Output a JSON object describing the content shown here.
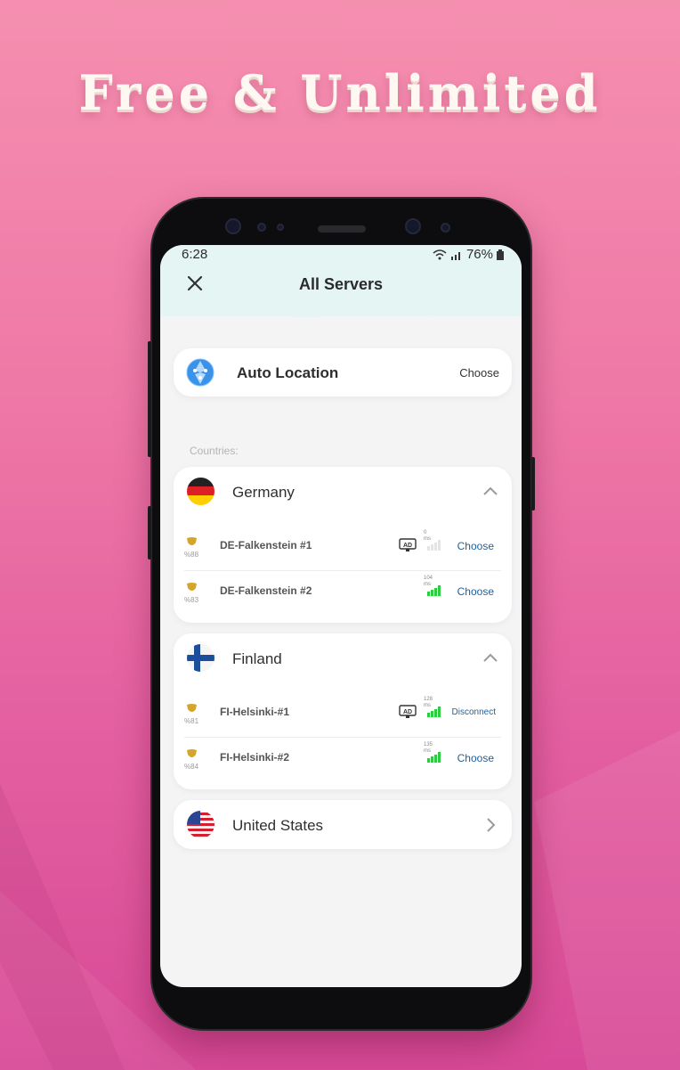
{
  "headline": "Free & Unlimited",
  "status_bar": {
    "time": "6:28",
    "battery": "76%"
  },
  "header": {
    "title": "All Servers"
  },
  "auto_location": {
    "label": "Auto Location",
    "action": "Choose"
  },
  "countries_label": "Countries:",
  "countries": [
    {
      "name": "Germany",
      "expanded": true,
      "servers": [
        {
          "name": "DE-Falkenstein #1",
          "load": "%88",
          "ping": "0",
          "unit": "ms",
          "ad": true,
          "action": "Choose"
        },
        {
          "name": "DE-Falkenstein #2",
          "load": "%83",
          "ping": "104",
          "unit": "ms",
          "ad": false,
          "action": "Choose"
        }
      ]
    },
    {
      "name": "Finland",
      "expanded": true,
      "servers": [
        {
          "name": "FI-Helsinki-#1",
          "load": "%81",
          "ping": "128",
          "unit": "ms",
          "ad": true,
          "action": "Disconnect"
        },
        {
          "name": "FI-Helsinki-#2",
          "load": "%84",
          "ping": "135",
          "unit": "ms",
          "ad": false,
          "action": "Choose"
        }
      ]
    },
    {
      "name": "United States",
      "expanded": false,
      "servers": []
    }
  ],
  "colors": {
    "accent_link": "#1f5f99",
    "signal_green": "#2ecc40",
    "header_mint": "#e4f5f3",
    "shield_gold": "#d4a52a"
  },
  "icons": [
    "close-icon",
    "globe-icon",
    "chevron-up-icon",
    "chevron-right-icon",
    "shield-icon",
    "ad-icon",
    "signal-icon",
    "flag-germany-icon",
    "flag-finland-icon",
    "flag-usa-icon"
  ]
}
